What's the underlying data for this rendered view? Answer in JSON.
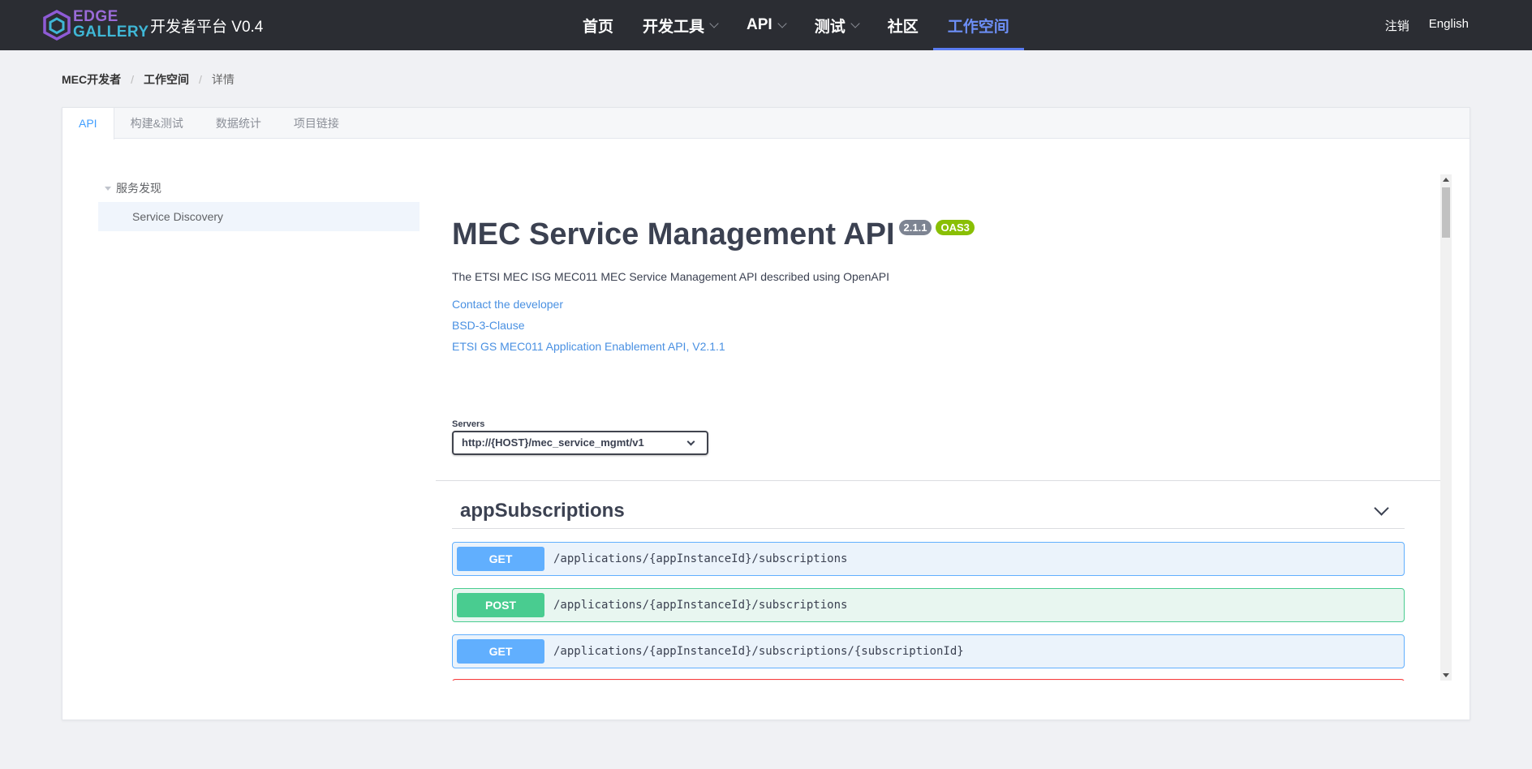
{
  "header": {
    "brand_line1": "EDGE",
    "brand_line2": "GALLERY",
    "platform": "开发者平台 V0.4",
    "nav": [
      {
        "label": "首页",
        "has_menu": false
      },
      {
        "label": "开发工具",
        "has_menu": true
      },
      {
        "label": "API",
        "has_menu": true
      },
      {
        "label": "测试",
        "has_menu": true
      },
      {
        "label": "社区",
        "has_menu": false
      },
      {
        "label": "工作空间",
        "has_menu": false,
        "active": true
      }
    ],
    "logout": "注销",
    "language": "English"
  },
  "breadcrumb": [
    "MEC开发者",
    "工作空间",
    "详情"
  ],
  "tabs": [
    "API",
    "构建&测试",
    "数据统计",
    "项目链接"
  ],
  "active_tab": "API",
  "tree": {
    "parent": "服务发现",
    "child": "Service Discovery"
  },
  "swagger": {
    "title": "MEC Service Management API",
    "version": "2.1.1",
    "oas": "OAS3",
    "description": "The ETSI MEC ISG MEC011 MEC Service Management API described using OpenAPI",
    "links": [
      "Contact the developer",
      "BSD-3-Clause",
      "ETSI GS MEC011 Application Enablement API, V2.1.1"
    ],
    "servers_label": "Servers",
    "server_value": "http://{HOST}/mec_service_mgmt/v1",
    "section": "appSubscriptions",
    "operations": [
      {
        "method": "GET",
        "path": "/applications/{appInstanceId}/subscriptions"
      },
      {
        "method": "POST",
        "path": "/applications/{appInstanceId}/subscriptions"
      },
      {
        "method": "GET",
        "path": "/applications/{appInstanceId}/subscriptions/{subscriptionId}"
      }
    ]
  },
  "colors": {
    "topbar": "#2b2d33",
    "nav_active": "#6d8ff7",
    "link": "#4990e2",
    "get": "#61affe",
    "post": "#49cc90",
    "delete": "#f93e3e",
    "oas_badge": "#89bf04"
  }
}
